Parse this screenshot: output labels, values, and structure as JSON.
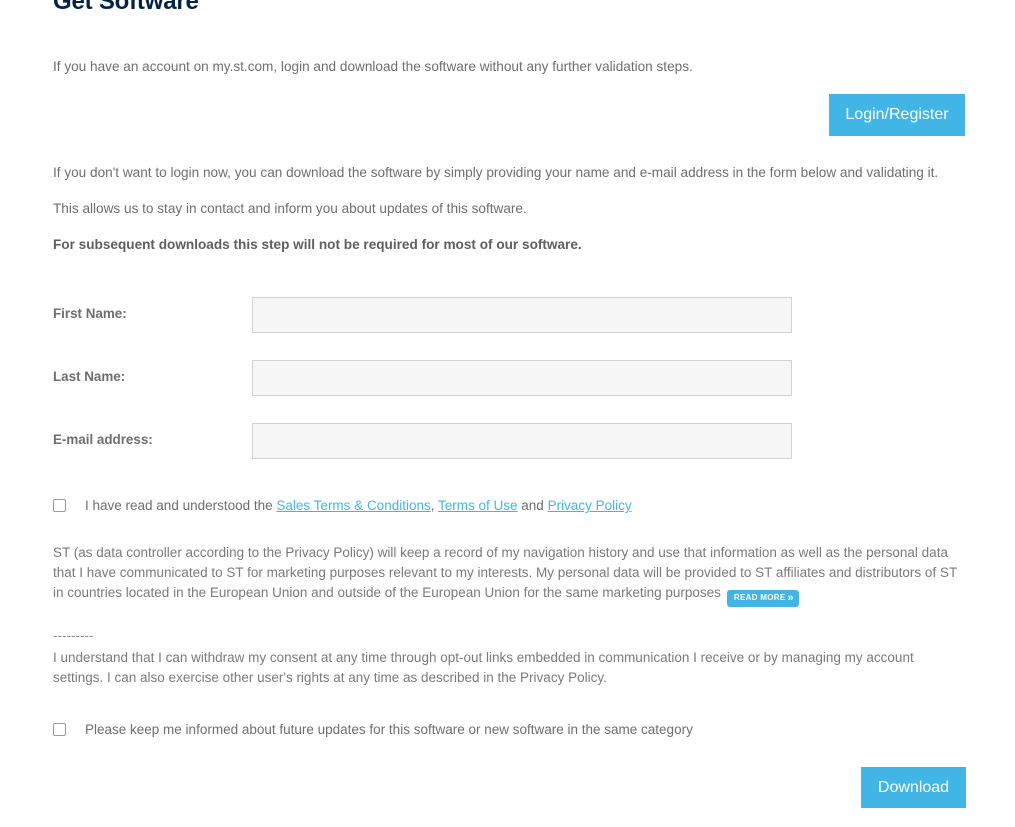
{
  "page": {
    "title": "Get Software"
  },
  "intro": {
    "text": "If you have an account on my.st.com, login and download the software without any further validation steps."
  },
  "login_button": {
    "label": "Login/Register"
  },
  "info": {
    "no_login": "If you don't want to login now, you can download the software by simply providing your name and e-mail address in the form below and validating it.",
    "stay_in_contact": "This allows us to stay in contact and inform you about updates of this software.",
    "subsequent_bold": "For subsequent downloads this step will not be required for most of our software."
  },
  "form": {
    "fields": [
      {
        "label": "First Name:",
        "value": "",
        "placeholder": ""
      },
      {
        "label": "Last Name:",
        "value": "",
        "placeholder": ""
      },
      {
        "label": "E-mail address:",
        "value": "",
        "placeholder": ""
      }
    ]
  },
  "terms": {
    "checked": false,
    "prefix": "I have read and understood the ",
    "link1": "Sales Terms & Conditions",
    "sep1": ", ",
    "link2": "Terms of Use",
    "sep2": " and ",
    "link3": "Privacy Policy"
  },
  "consent": {
    "text": "ST (as data controller according to the Privacy Policy) will keep a record of my navigation history and use that information as well as the personal data that I have communicated to ST for marketing purposes relevant to my interests. My personal data will be provided to ST affiliates and distributors of ST in countries located in the European Union and outside of the European Union for the same marketing purposes",
    "read_more_label": "READ MORE",
    "read_more_chevron": "»"
  },
  "separator": {
    "dashes": "---------"
  },
  "withdraw": {
    "text": "I understand that I can withdraw my consent at any time through opt-out links embedded in communication I receive or by managing my account settings. I can also exercise other user's rights at any time as described in the Privacy Policy."
  },
  "keep_informed": {
    "checked": false,
    "label": "Please keep me informed about future updates for this software or new software in the same category"
  },
  "download_button": {
    "label": "Download"
  },
  "colors": {
    "accent": "#41b6e6",
    "title": "#03234b",
    "body_text": "#6e6e6e",
    "input_bg": "#f6f6f6",
    "input_border": "#d3d3d3"
  }
}
